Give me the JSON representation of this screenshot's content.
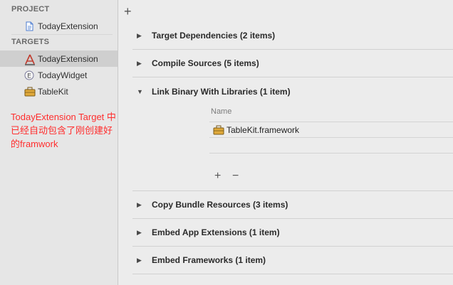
{
  "sidebar": {
    "project_header": "PROJECT",
    "project_item": {
      "label": "TodayExtension",
      "icon": "document-icon"
    },
    "targets_header": "TARGETS",
    "targets": [
      {
        "label": "TodayExtension",
        "icon": "app-target-icon",
        "selected": true
      },
      {
        "label": "TodayWidget",
        "icon": "extension-icon",
        "selected": false
      },
      {
        "label": "TableKit",
        "icon": "framework-toolbox-icon",
        "selected": false
      }
    ],
    "annotation": "TodayExtension Target 中已经自动包含了刚创建好的framwork",
    "annotation_color": "#ff2d2d"
  },
  "toolbar": {
    "add_label": "+"
  },
  "phases": [
    {
      "title": "Target Dependencies (2 items)",
      "expanded": false
    },
    {
      "title": "Compile Sources (5 items)",
      "expanded": false
    },
    {
      "title": "Link Binary With Libraries (1 item)",
      "expanded": true
    },
    {
      "title": "Copy Bundle Resources (3 items)",
      "expanded": false
    },
    {
      "title": "Embed App Extensions (1 item)",
      "expanded": false
    },
    {
      "title": "Embed Frameworks (1 item)",
      "expanded": false
    }
  ],
  "libraries": {
    "column_header": "Name",
    "rows": [
      {
        "label": "TableKit.framework",
        "icon": "framework-toolbox-icon"
      }
    ],
    "add_label": "+",
    "remove_label": "−"
  },
  "glyphs": {
    "collapsed": "▶",
    "expanded": "▼"
  }
}
